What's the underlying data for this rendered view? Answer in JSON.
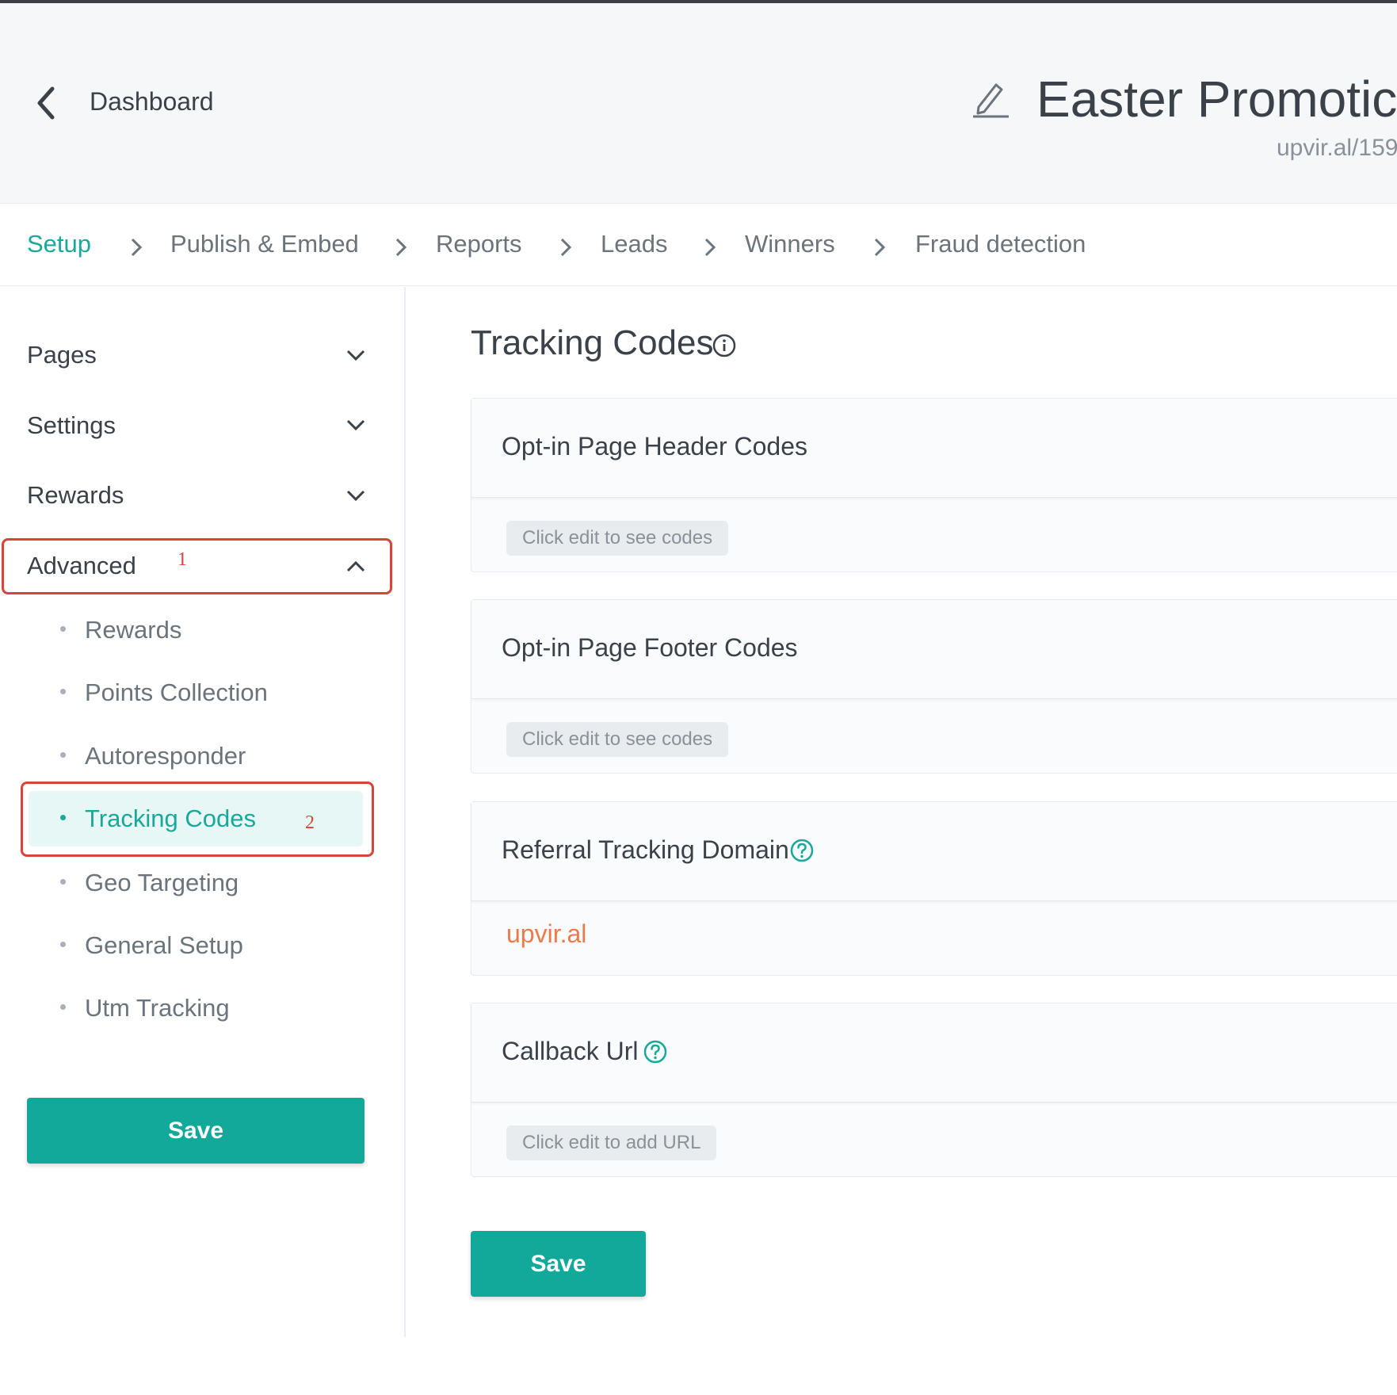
{
  "header": {
    "back_label": "Dashboard",
    "title": "Easter Promotic",
    "url": "upvir.al/159"
  },
  "tabs": [
    {
      "label": "Setup",
      "active": true
    },
    {
      "label": "Publish & Embed"
    },
    {
      "label": "Reports"
    },
    {
      "label": "Leads"
    },
    {
      "label": "Winners"
    },
    {
      "label": "Fraud detection"
    }
  ],
  "sidebar": {
    "sections": [
      {
        "label": "Pages"
      },
      {
        "label": "Settings"
      },
      {
        "label": "Rewards"
      },
      {
        "label": "Advanced"
      }
    ],
    "advanced_items": [
      {
        "label": "Rewards"
      },
      {
        "label": "Points Collection"
      },
      {
        "label": "Autoresponder"
      },
      {
        "label": "Tracking Codes",
        "active": true
      },
      {
        "label": "Geo Targeting"
      },
      {
        "label": "General Setup"
      },
      {
        "label": "Utm Tracking"
      }
    ],
    "save_label": "Save"
  },
  "annotations": {
    "one": "1",
    "two": "2"
  },
  "main": {
    "title": "Tracking Codes",
    "cards": [
      {
        "title": "Opt-in Page Header Codes",
        "value": "Click edit to see codes"
      },
      {
        "title": "Opt-in Page Footer Codes",
        "value": "Click edit to see codes"
      },
      {
        "title": "Referral Tracking Domain",
        "value": "upvir.al"
      },
      {
        "title": "Callback Url",
        "value": "Click edit to add URL"
      }
    ],
    "save_label": "Save"
  },
  "colors": {
    "accent": "#1aa89a",
    "button": "#12a99b",
    "highlight": "#d9443a",
    "domain": "#ec7a4a"
  }
}
